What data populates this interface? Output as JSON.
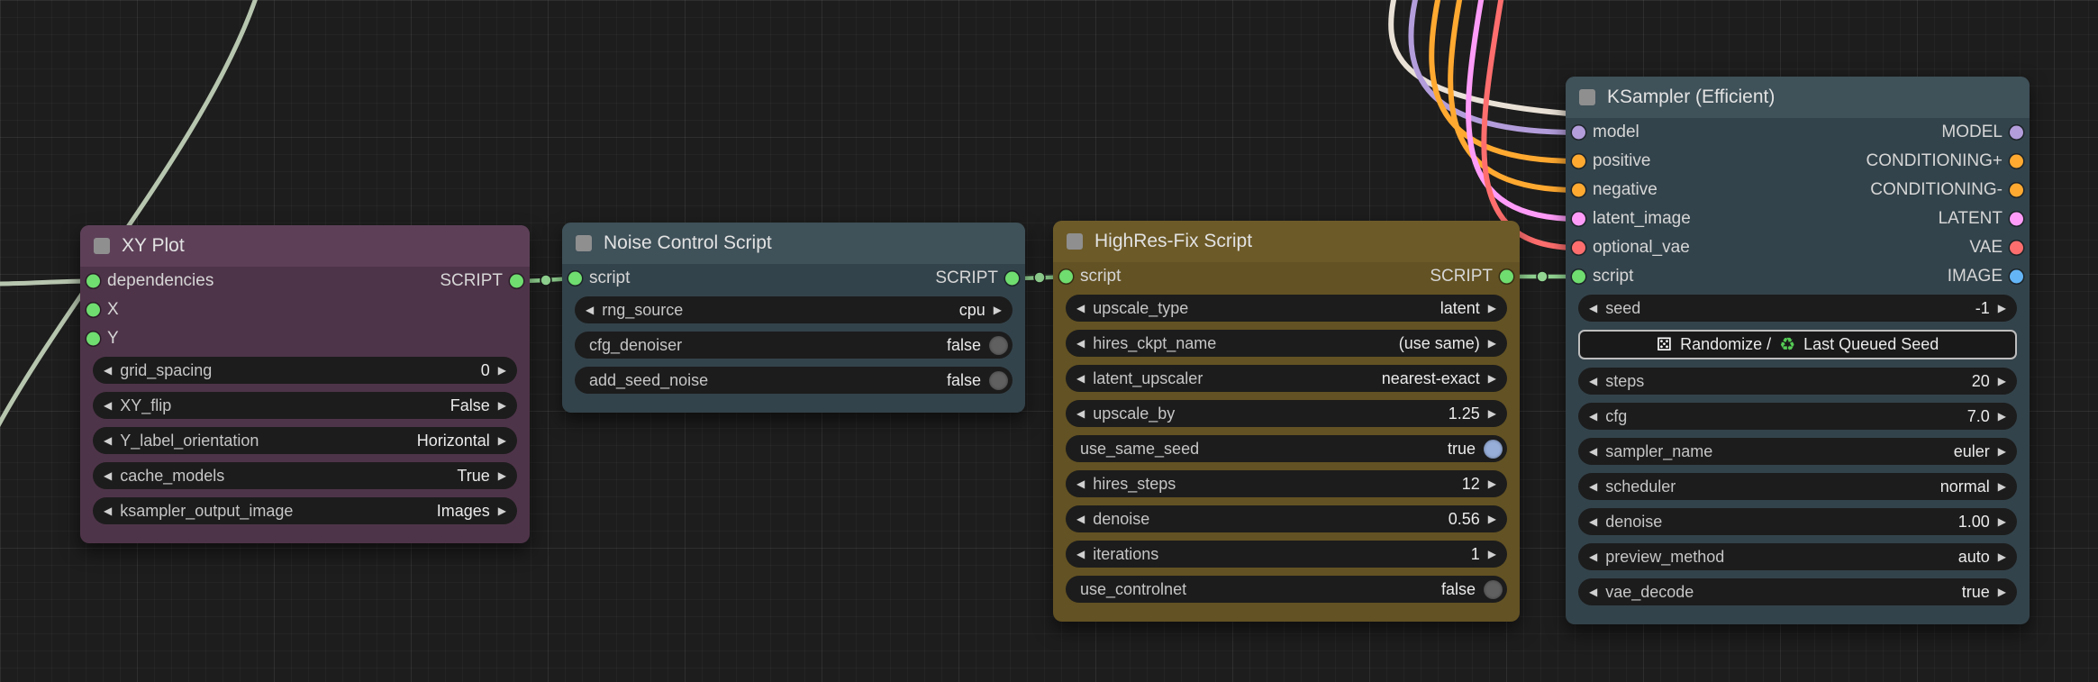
{
  "app": {
    "name": "node graph editor canvas"
  },
  "canvas": {
    "background": "#1d1d1d"
  },
  "icons": {
    "left_arrow": "◀",
    "right_arrow": "▶",
    "dice": "⚄",
    "recycle": "♻"
  },
  "colors": {
    "toggle_on": "#97aed8",
    "toggle_off": "#606060",
    "widget_bg": "#1c1c1c",
    "script_link": "#93d693",
    "dice_icon": "#ffffff",
    "recycle_icon": "#55cc55"
  },
  "nodes": [
    {
      "key": "xy-plot",
      "title": "XY Plot",
      "colors": {
        "header": "#5d4058",
        "body": "#4e3449"
      },
      "slots": [
        {
          "input": {
            "label": "dependencies",
            "color": "#6fdd6f"
          },
          "output": {
            "label": "SCRIPT",
            "color": "#6fdd6f"
          }
        },
        {
          "input": {
            "label": "X",
            "color": "#6fdd6f"
          }
        },
        {
          "input": {
            "label": "Y",
            "color": "#6fdd6f"
          }
        }
      ],
      "widgets": [
        {
          "type": "combo",
          "label": "grid_spacing",
          "value": "0"
        },
        {
          "type": "combo",
          "label": "XY_flip",
          "value": "False"
        },
        {
          "type": "combo",
          "label": "Y_label_orientation",
          "value": "Horizontal"
        },
        {
          "type": "combo",
          "label": "cache_models",
          "value": "True"
        },
        {
          "type": "combo",
          "label": "ksampler_output_image",
          "value": "Images"
        }
      ]
    },
    {
      "key": "noise-control",
      "title": "Noise Control Script",
      "colors": {
        "header": "#3f5159",
        "body": "#33434b"
      },
      "slots": [
        {
          "input": {
            "label": "script",
            "color": "#6fdd6f"
          },
          "output": {
            "label": "SCRIPT",
            "color": "#6fdd6f"
          }
        }
      ],
      "widgets": [
        {
          "type": "combo",
          "label": "rng_source",
          "value": "cpu"
        },
        {
          "type": "toggle",
          "label": "cfg_denoiser",
          "value": "false"
        },
        {
          "type": "toggle",
          "label": "add_seed_noise",
          "value": "false"
        }
      ]
    },
    {
      "key": "highres-fix",
      "title": "HighRes-Fix Script",
      "colors": {
        "header": "#6c5a28",
        "body": "#635223"
      },
      "slots": [
        {
          "input": {
            "label": "script",
            "color": "#6fdd6f"
          },
          "output": {
            "label": "SCRIPT",
            "color": "#6fdd6f"
          }
        }
      ],
      "widgets": [
        {
          "type": "combo",
          "label": "upscale_type",
          "value": "latent"
        },
        {
          "type": "combo",
          "label": "hires_ckpt_name",
          "value": "(use same)"
        },
        {
          "type": "combo",
          "label": "latent_upscaler",
          "value": "nearest-exact"
        },
        {
          "type": "combo",
          "label": "upscale_by",
          "value": "1.25"
        },
        {
          "type": "toggle",
          "label": "use_same_seed",
          "value": "true"
        },
        {
          "type": "combo",
          "label": "hires_steps",
          "value": "12"
        },
        {
          "type": "combo",
          "label": "denoise",
          "value": "0.56"
        },
        {
          "type": "combo",
          "label": "iterations",
          "value": "1"
        },
        {
          "type": "toggle",
          "label": "use_controlnet",
          "value": "false"
        }
      ]
    },
    {
      "key": "ksampler",
      "title": "KSampler (Efficient)",
      "colors": {
        "header": "#3f5159",
        "body": "#33434b"
      },
      "slots": [
        {
          "input": {
            "label": "model",
            "color": "#b39ddb"
          },
          "output": {
            "label": "MODEL",
            "color": "#b39ddb"
          }
        },
        {
          "input": {
            "label": "positive",
            "color": "#ffa931"
          },
          "output": {
            "label": "CONDITIONING+",
            "color": "#ffa931"
          }
        },
        {
          "input": {
            "label": "negative",
            "color": "#ffa931"
          },
          "output": {
            "label": "CONDITIONING-",
            "color": "#ffa931"
          }
        },
        {
          "input": {
            "label": "latent_image",
            "color": "#ff9cf9"
          },
          "output": {
            "label": "LATENT",
            "color": "#ff9cf9"
          }
        },
        {
          "input": {
            "label": "optional_vae",
            "color": "#ff6e6e"
          },
          "output": {
            "label": "VAE",
            "color": "#ff6e6e"
          }
        },
        {
          "input": {
            "label": "script",
            "color": "#6fdd6f"
          },
          "output": {
            "label": "IMAGE",
            "color": "#64b5f6"
          }
        }
      ],
      "widgets": [
        {
          "type": "combo",
          "label": "seed",
          "value": "-1"
        },
        {
          "type": "button",
          "text_before": "Randomize /",
          "text_after": "Last Queued Seed"
        },
        {
          "type": "combo",
          "label": "steps",
          "value": "20"
        },
        {
          "type": "combo",
          "label": "cfg",
          "value": "7.0"
        },
        {
          "type": "combo",
          "label": "sampler_name",
          "value": "euler"
        },
        {
          "type": "combo",
          "label": "scheduler",
          "value": "normal"
        },
        {
          "type": "combo",
          "label": "denoise",
          "value": "1.00"
        },
        {
          "type": "combo",
          "label": "preview_method",
          "value": "auto"
        },
        {
          "type": "combo",
          "label": "vae_decode",
          "value": "true"
        }
      ]
    }
  ],
  "links": [
    {
      "id": "offscreen-left-pass",
      "type": "unknown",
      "color": "#b7c6af"
    },
    {
      "id": "offscreen-left-to-dependencies",
      "type": "unknown",
      "color": "#b7c6af"
    },
    {
      "id": "xyplot-to-noise",
      "type": "SCRIPT",
      "color": "#93d693"
    },
    {
      "id": "noise-to-highres",
      "type": "SCRIPT",
      "color": "#93d693"
    },
    {
      "id": "highres-to-ksampler",
      "type": "SCRIPT",
      "color": "#93d693"
    },
    {
      "id": "top-pale",
      "type": "unknown",
      "color": "#e9e1d6"
    },
    {
      "id": "top-model",
      "type": "MODEL",
      "color": "#b39ddb"
    },
    {
      "id": "top-positive",
      "type": "CONDITIONING",
      "color": "#ffa931"
    },
    {
      "id": "top-negative",
      "type": "CONDITIONING",
      "color": "#ffa931"
    },
    {
      "id": "top-latent",
      "type": "LATENT",
      "color": "#ff9cf9"
    },
    {
      "id": "top-vae",
      "type": "VAE",
      "color": "#ff6e6e"
    }
  ]
}
